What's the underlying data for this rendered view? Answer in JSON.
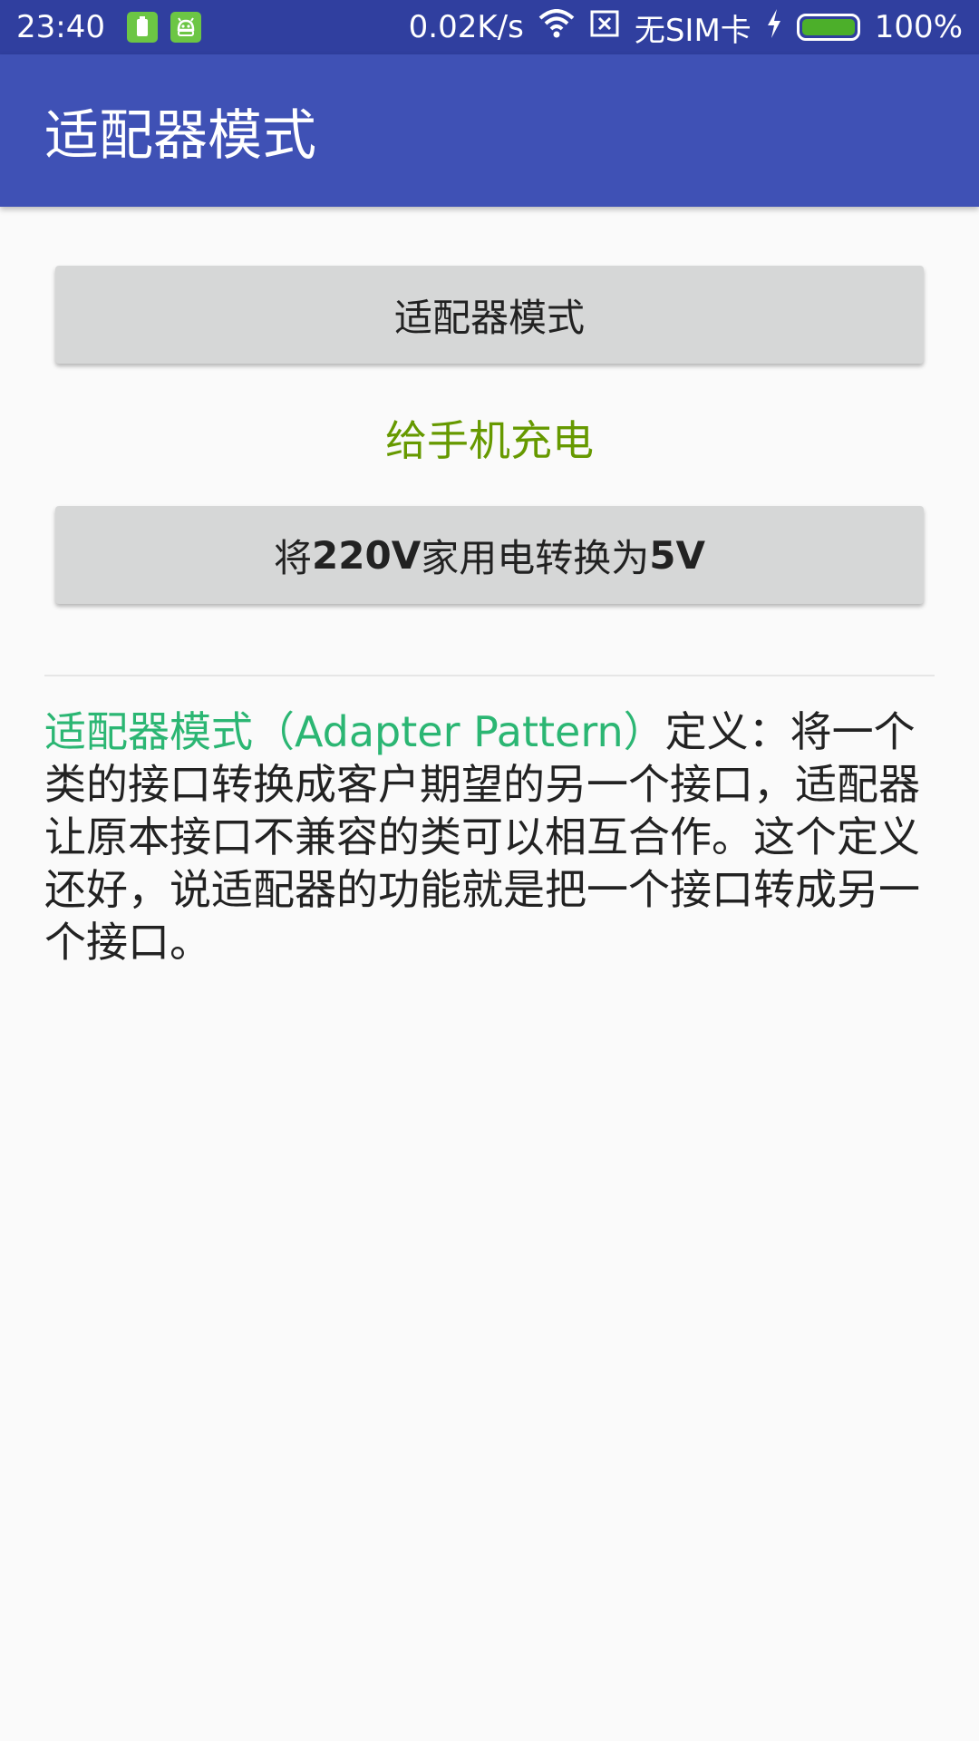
{
  "status_bar": {
    "time": "23:40",
    "network_speed": "0.02K/s",
    "sim_text": "无SIM卡",
    "battery_percent": "100%",
    "icons": [
      "battery-notification-icon",
      "android-notification-icon",
      "wifi-icon",
      "no-sim-icon",
      "charging-bolt-icon",
      "battery-icon"
    ],
    "colors": {
      "background": "#303f9f",
      "battery_fill": "#4caf2a"
    }
  },
  "app_bar": {
    "title": "适配器模式",
    "color": "#3f51b5"
  },
  "main": {
    "button1_label": "适配器模式",
    "charge_label": "给手机充电",
    "charge_color": "#669900",
    "button2": {
      "prefix": "将",
      "voltage_from": "220V",
      "middle": "家用电转换为",
      "voltage_to": "5V"
    },
    "description": {
      "highlight": "适配器模式（Adapter Pattern）",
      "highlight_color": "#2bb673",
      "body": "定义：将一个类的接口转换成客户期望的另一个接口，适配器让原本接口不兼容的类可以相互合作。这个定义还好，说适配器的功能就是把一个接口转成另一个接口。"
    }
  }
}
